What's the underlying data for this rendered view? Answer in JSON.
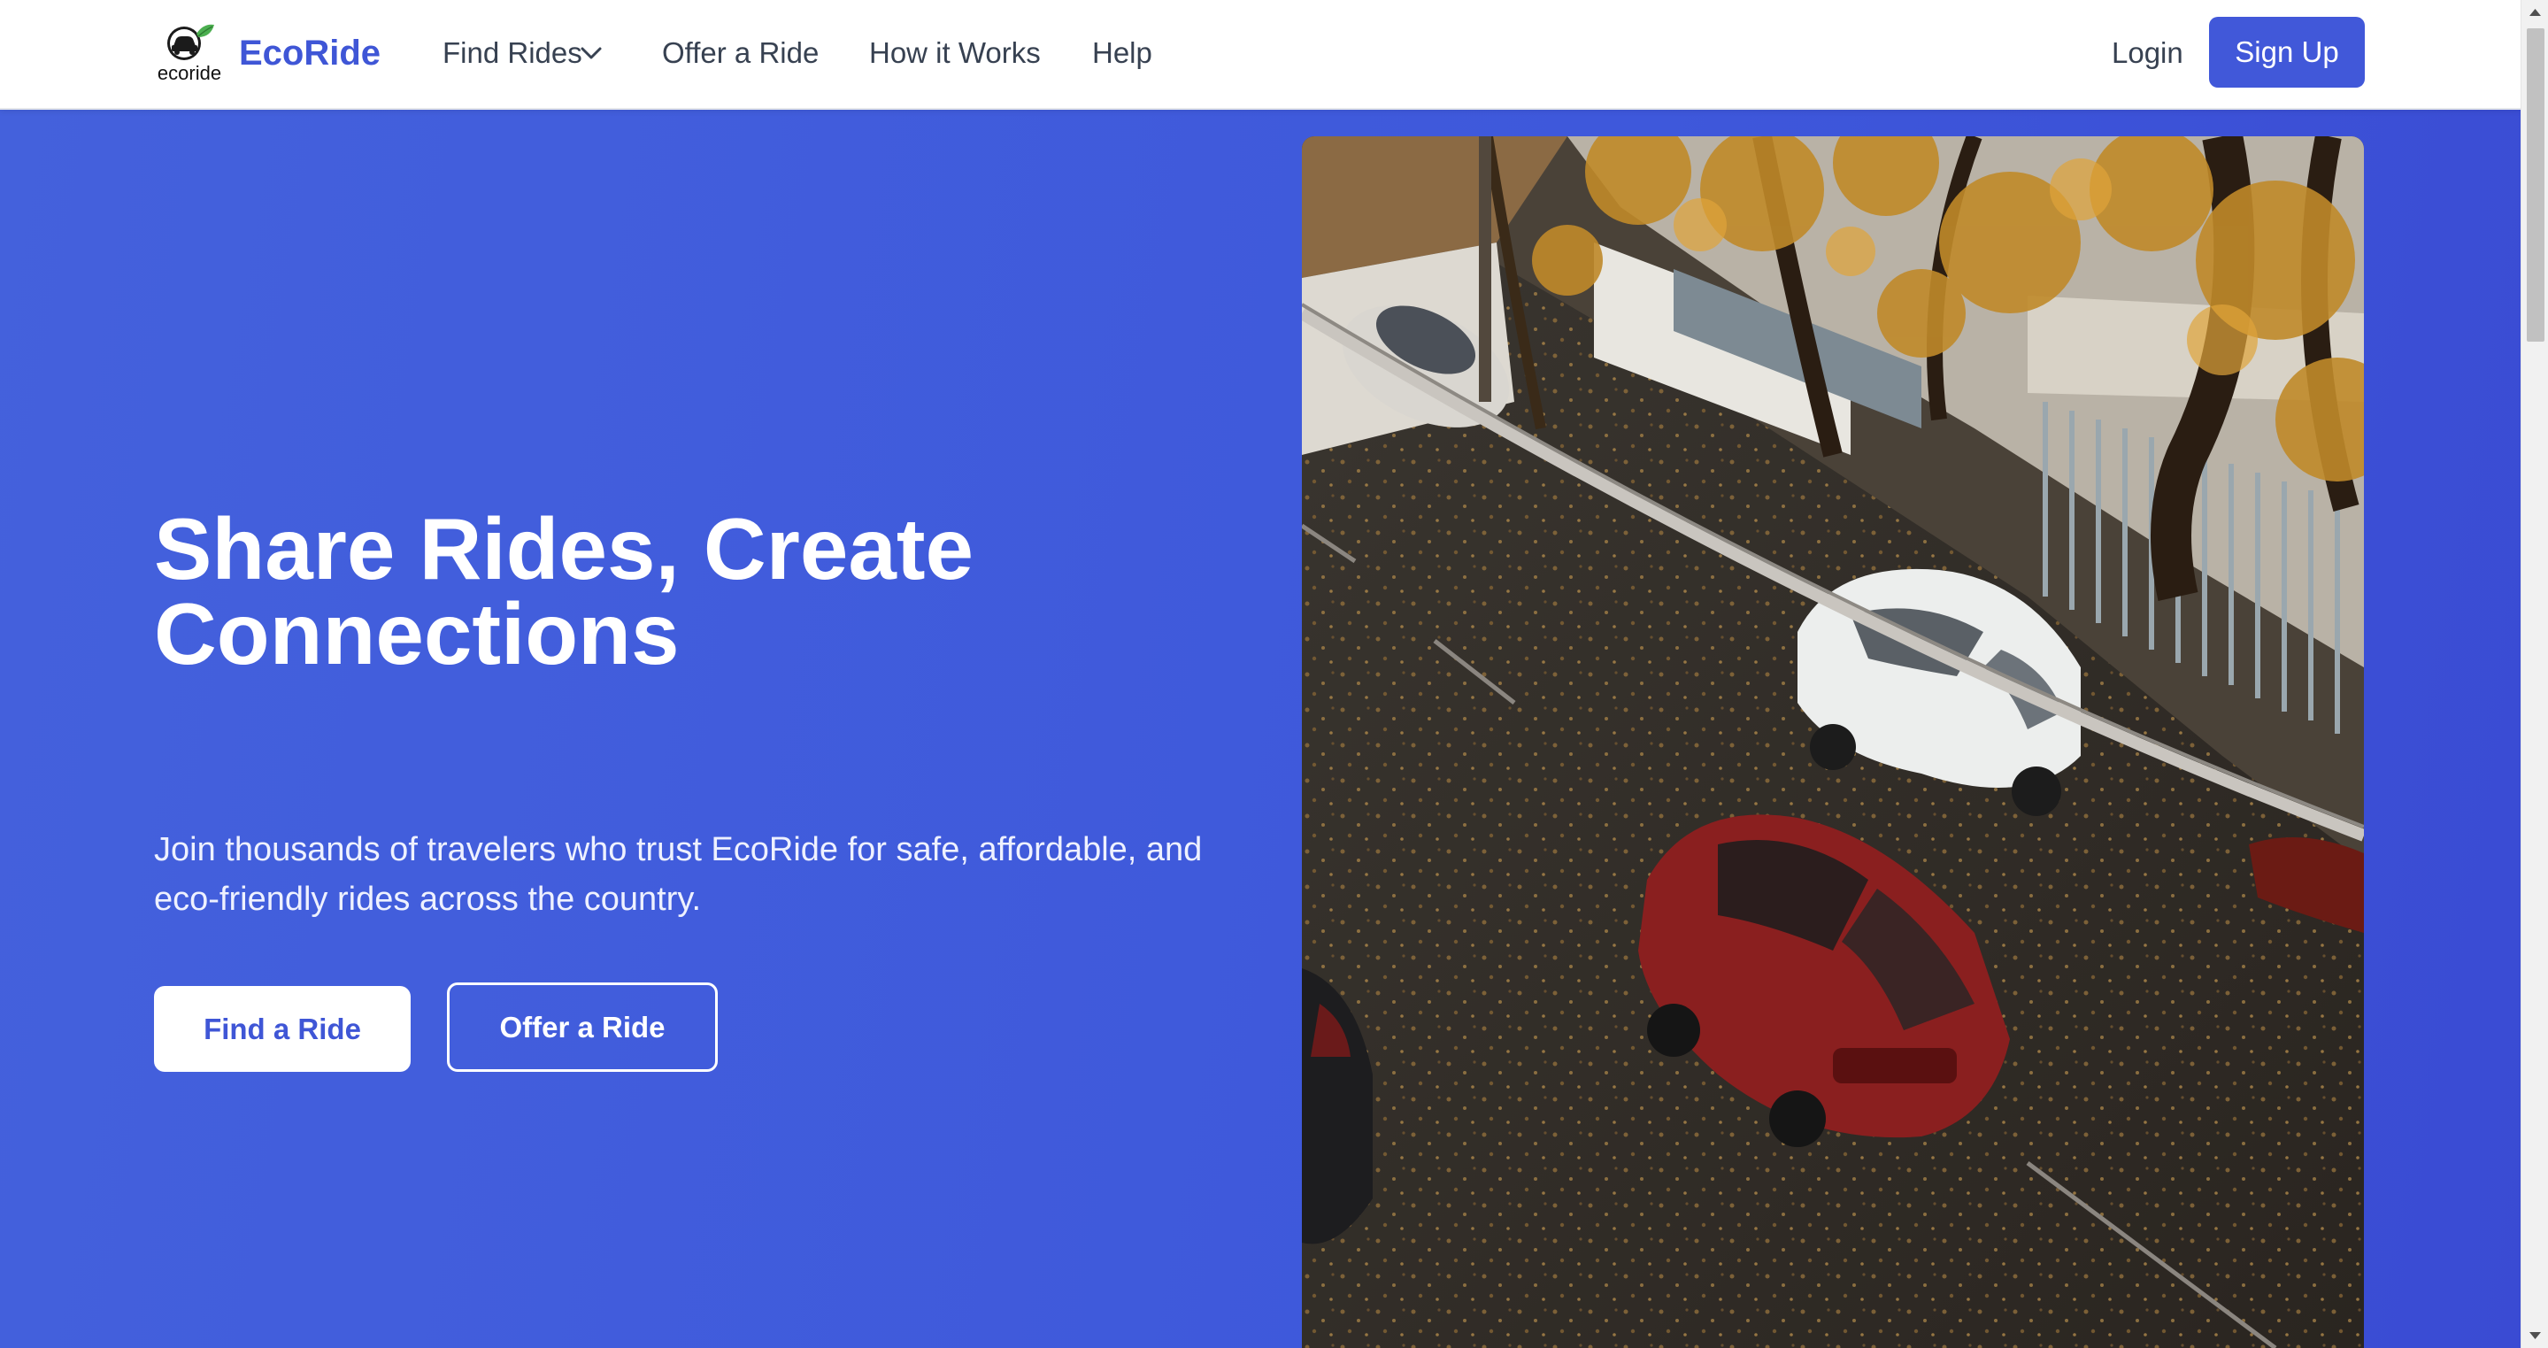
{
  "colors": {
    "brand": "#3f56d6",
    "hero_bg": "#4160dc",
    "signup_bg": "#4158d9",
    "nav_text": "#374151"
  },
  "header": {
    "logo_text": "ecoride",
    "logo_icon": "car-leaf-logo",
    "brand": "EcoRide",
    "nav": {
      "find_rides": "Find Rides",
      "offer_ride": "Offer a Ride",
      "how_it_works": "How it Works",
      "help": "Help"
    },
    "login": "Login",
    "signup": "Sign Up"
  },
  "hero": {
    "headline_line1": "Share Rides, Create",
    "headline_line2": "Connections",
    "subtext": "Join thousands of travelers who trust EcoRide for safe, affordable, and eco-friendly rides across the country.",
    "find_button": "Find a Ride",
    "offer_button": "Offer a Ride",
    "image": "street-with-parked-cars-photo"
  }
}
